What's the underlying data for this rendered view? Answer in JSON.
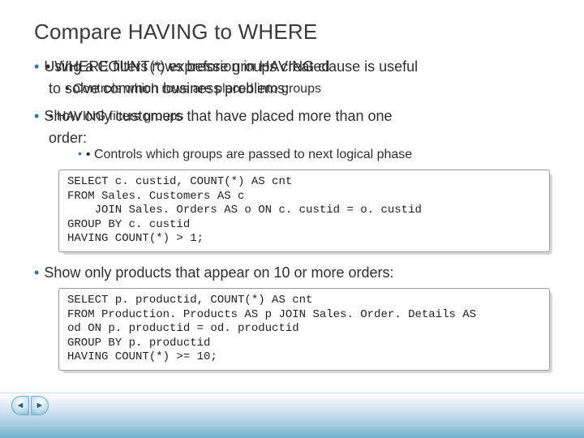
{
  "title": "Compare HAVING to WHERE",
  "bullets": {
    "b1_layerA": "Using a COUNT(*) expression in HAVING clause is useful",
    "b1_layerB": "• WHERE filters rows before groups created",
    "b2_layerA": "to solve common business problems:",
    "b2_layerB": "• Controls which rows are placed into groups",
    "b3_layerA": "Show only customers that have placed more than one",
    "b3_layerB": "• HAVING filters groups",
    "b4": "order:",
    "b5": "• Controls which groups are passed to next logical phase",
    "b6": "Show only products that appear on 10 or more orders:"
  },
  "code1": "SELECT c. custid, COUNT(*) AS cnt\nFROM Sales. Customers AS c\n    JOIN Sales. Orders AS o ON c. custid = o. custid\nGROUP BY c. custid\nHAVING COUNT(*) > 1;",
  "code2": "SELECT p. productid, COUNT(*) AS cnt\nFROM Production. Products AS p JOIN Sales. Order. Details AS\nod ON p. productid = od. productid\nGROUP BY p. productid\nHAVING COUNT(*) >= 10;",
  "nav": {
    "prev": "◄",
    "next": "►"
  }
}
